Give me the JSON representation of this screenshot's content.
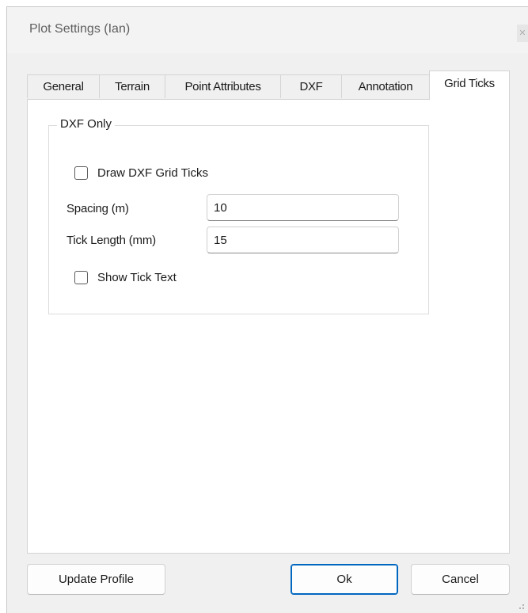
{
  "window": {
    "title": "Plot Settings  (Ian)"
  },
  "tabs": [
    {
      "label": "General",
      "active": false
    },
    {
      "label": "Terrain",
      "active": false
    },
    {
      "label": "Point Attributes",
      "active": false
    },
    {
      "label": "DXF",
      "active": false
    },
    {
      "label": "Annotation",
      "active": false
    },
    {
      "label": "Grid Ticks",
      "active": true
    }
  ],
  "group": {
    "legend": "DXF Only",
    "draw_ticks": {
      "label": "Draw DXF Grid Ticks",
      "checked": false
    },
    "spacing": {
      "label": "Spacing (m)",
      "value": "10"
    },
    "tick_length": {
      "label": "Tick Length (mm)",
      "value": "15"
    },
    "show_text": {
      "label": "Show Tick Text",
      "checked": false
    }
  },
  "buttons": {
    "update_profile": "Update Profile",
    "ok": "Ok",
    "cancel": "Cancel"
  },
  "colors": {
    "accent": "#0067c0",
    "dialog_bg": "#f0f0f0",
    "panel_bg": "#ffffff"
  }
}
